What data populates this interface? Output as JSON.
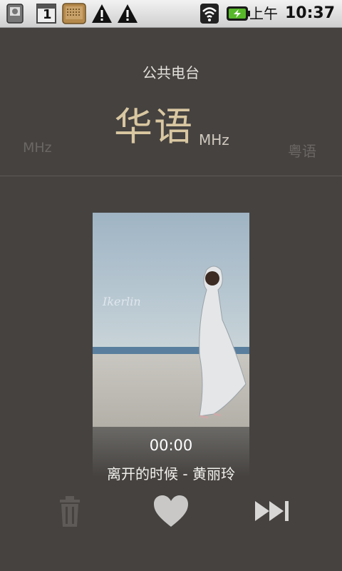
{
  "status_bar": {
    "ampm": "上午",
    "time": "10:37",
    "icons": [
      "sd-card-icon",
      "calendar-icon",
      "radio-app-icon",
      "warning-icon",
      "warning-icon",
      "wifi-icon",
      "battery-charging-icon"
    ],
    "calendar_day": "1"
  },
  "station": {
    "category": "公共电台",
    "current_name": "华语",
    "current_unit": "MHz",
    "prev_unit": "MHz",
    "next_name": "粤语"
  },
  "player": {
    "time": "00:00",
    "track": "离开的时候 - 黄丽玲",
    "album_watermark": "Ikerlin"
  },
  "controls": {
    "icons": [
      "trash-icon",
      "heart-icon",
      "skip-next-icon"
    ]
  },
  "colors": {
    "background": "#454240",
    "accent_title": "#d9c7a1"
  }
}
